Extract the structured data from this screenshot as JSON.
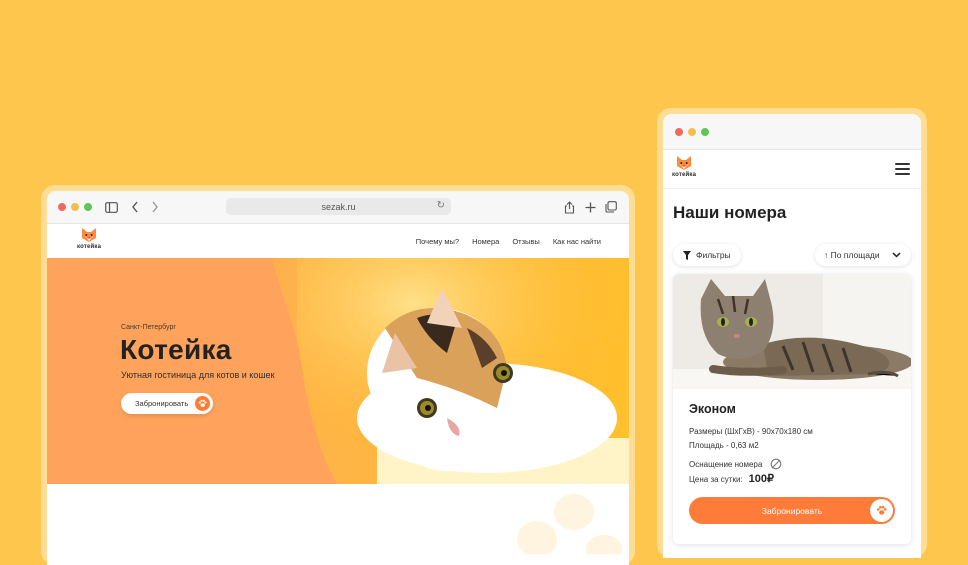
{
  "desktop": {
    "url": "sezak.ru",
    "logo_text": "котейка",
    "nav": [
      "Почему мы?",
      "Номера",
      "Отзывы",
      "Как нас найти"
    ],
    "hero": {
      "city": "Санкт-Петербург",
      "title": "Котейка",
      "tagline": "Уютная гостиница для котов и кошек",
      "button": "Забронировать"
    }
  },
  "mobile": {
    "logo_text": "котейка",
    "page_title": "Наши номера",
    "filter_label": "Фильтры",
    "sort_label": "↑ По площади",
    "room": {
      "name": "Эконом",
      "size": "Размеры (ШxГxВ) - 90x70x180 см",
      "area": "Площадь - 0,63 м2",
      "equipment": "Оснащение номера",
      "price_label": "Цена за сутки:",
      "price": "100₽",
      "button": "Забронировать"
    }
  },
  "colors": {
    "background": "#FFC64E",
    "accent": "#FF7B3A",
    "frame": "#FFDD95"
  }
}
